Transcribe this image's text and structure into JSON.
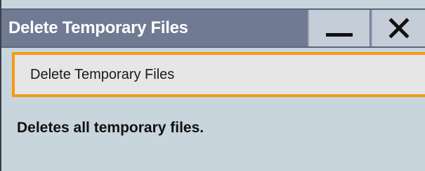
{
  "window": {
    "title": "Delete Temporary Files",
    "minimize_icon": "minimize-icon",
    "close_icon": "close-icon"
  },
  "main": {
    "action_button_label": "Delete Temporary Files",
    "description": "Deletes all temporary files."
  },
  "colors": {
    "titlebar": "#717a93",
    "focus_border": "#f39a15",
    "panel_background": "#c8d5dd",
    "button_background": "#e6e6e6"
  }
}
